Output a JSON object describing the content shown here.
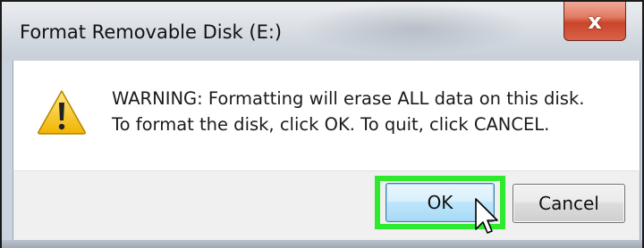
{
  "dialog": {
    "title": "Format Removable Disk (E:)",
    "close_glyph": "x",
    "icon": "warning-icon",
    "message_line1": "WARNING: Formatting will erase ALL data on this disk.",
    "message_line2": "To format the disk, click OK. To quit, click CANCEL.",
    "ok_label": "OK",
    "cancel_label": "Cancel"
  },
  "colors": {
    "highlight": "#2dea2d",
    "close_button": "#c9442a",
    "warning_fill": "#f5c400"
  }
}
